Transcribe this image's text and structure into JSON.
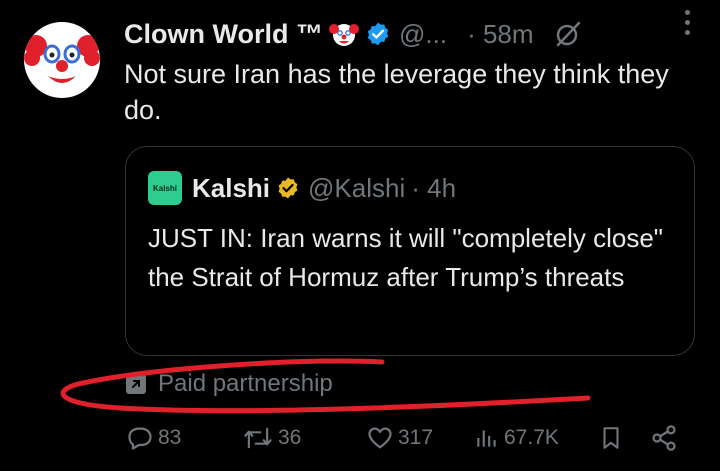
{
  "author": {
    "name": "Clown World ™",
    "handle": "@...",
    "time": "· 58m",
    "avatar_icon": "clown-face-icon",
    "verified_color": "#1d9bf0"
  },
  "tweet": {
    "text": "Not sure Iran has the leverage they think they do."
  },
  "quote": {
    "logo_text": "Kalshi",
    "name": "Kalshi",
    "handle": "@Kalshi",
    "time": "· 4h",
    "text": "JUST IN: Iran warns it will \"completely close\" the Strait of Hormuz after Trump’s threats",
    "badge_color": "#e8b923",
    "logo_color": "#2ecc8f"
  },
  "paid_label": "Paid partnership",
  "actions": {
    "replies": "83",
    "retweets": "36",
    "likes": "317",
    "views": "67.7K"
  },
  "annotation_color": "#e0202a"
}
